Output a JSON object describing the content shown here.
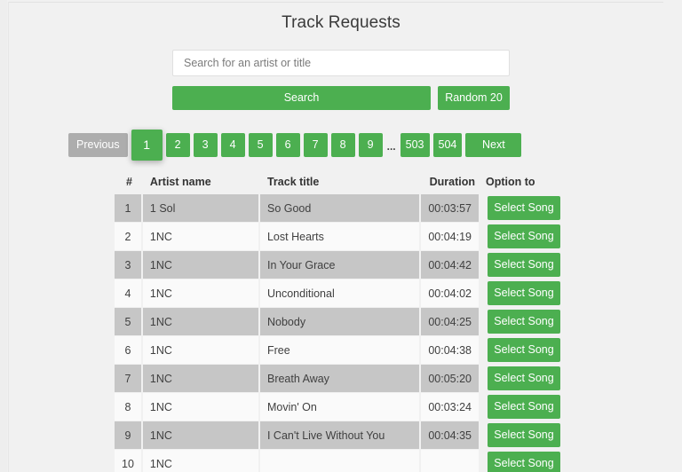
{
  "page": {
    "title": "Track Requests"
  },
  "search": {
    "value": "",
    "placeholder": "Search for an artist or title",
    "search_button": "Search",
    "random_button": "Random 20"
  },
  "pagination": {
    "previous": "Previous",
    "next": "Next",
    "ellipsis": "...",
    "active_page": "1",
    "pages": [
      "1",
      "2",
      "3",
      "4",
      "5",
      "6",
      "7",
      "8",
      "9"
    ],
    "tail_pages": [
      "503",
      "504"
    ]
  },
  "table": {
    "headers": {
      "num": "#",
      "artist": "Artist name",
      "title": "Track title",
      "duration": "Duration",
      "option": "Option to"
    },
    "select_label": "Select Song",
    "rows": [
      {
        "num": "1",
        "artist": "1 Sol",
        "title": "So Good",
        "duration": "00:03:57",
        "action": "Select Song"
      },
      {
        "num": "2",
        "artist": "1NC",
        "title": "Lost Hearts",
        "duration": "00:04:19",
        "action": "Select Song"
      },
      {
        "num": "3",
        "artist": "1NC",
        "title": "In Your Grace",
        "duration": "00:04:42",
        "action": "Select Song"
      },
      {
        "num": "4",
        "artist": "1NC",
        "title": "Unconditional",
        "duration": "00:04:02",
        "action": "Select Song"
      },
      {
        "num": "5",
        "artist": "1NC",
        "title": "Nobody",
        "duration": "00:04:25",
        "action": "Select Song"
      },
      {
        "num": "6",
        "artist": "1NC",
        "title": "Free",
        "duration": "00:04:38",
        "action": "Select Song"
      },
      {
        "num": "7",
        "artist": "1NC",
        "title": "Breath Away",
        "duration": "00:05:20",
        "action": "Select Song"
      },
      {
        "num": "8",
        "artist": "1NC",
        "title": "Movin' On",
        "duration": "00:03:24",
        "action": "Select Song"
      },
      {
        "num": "9",
        "artist": "1NC",
        "title": "I Can't Live Without You",
        "duration": "00:04:35",
        "action": "Select Song"
      },
      {
        "num": "10",
        "artist": "1NC",
        "title": "",
        "duration": "",
        "action": "Select Song"
      }
    ]
  },
  "colors": {
    "accent_green": "#4caf50",
    "disabled_gray": "#adadad",
    "page_background": "#f1f1f1",
    "row_odd": "#c6c6c6",
    "row_even": "#fafafa"
  }
}
